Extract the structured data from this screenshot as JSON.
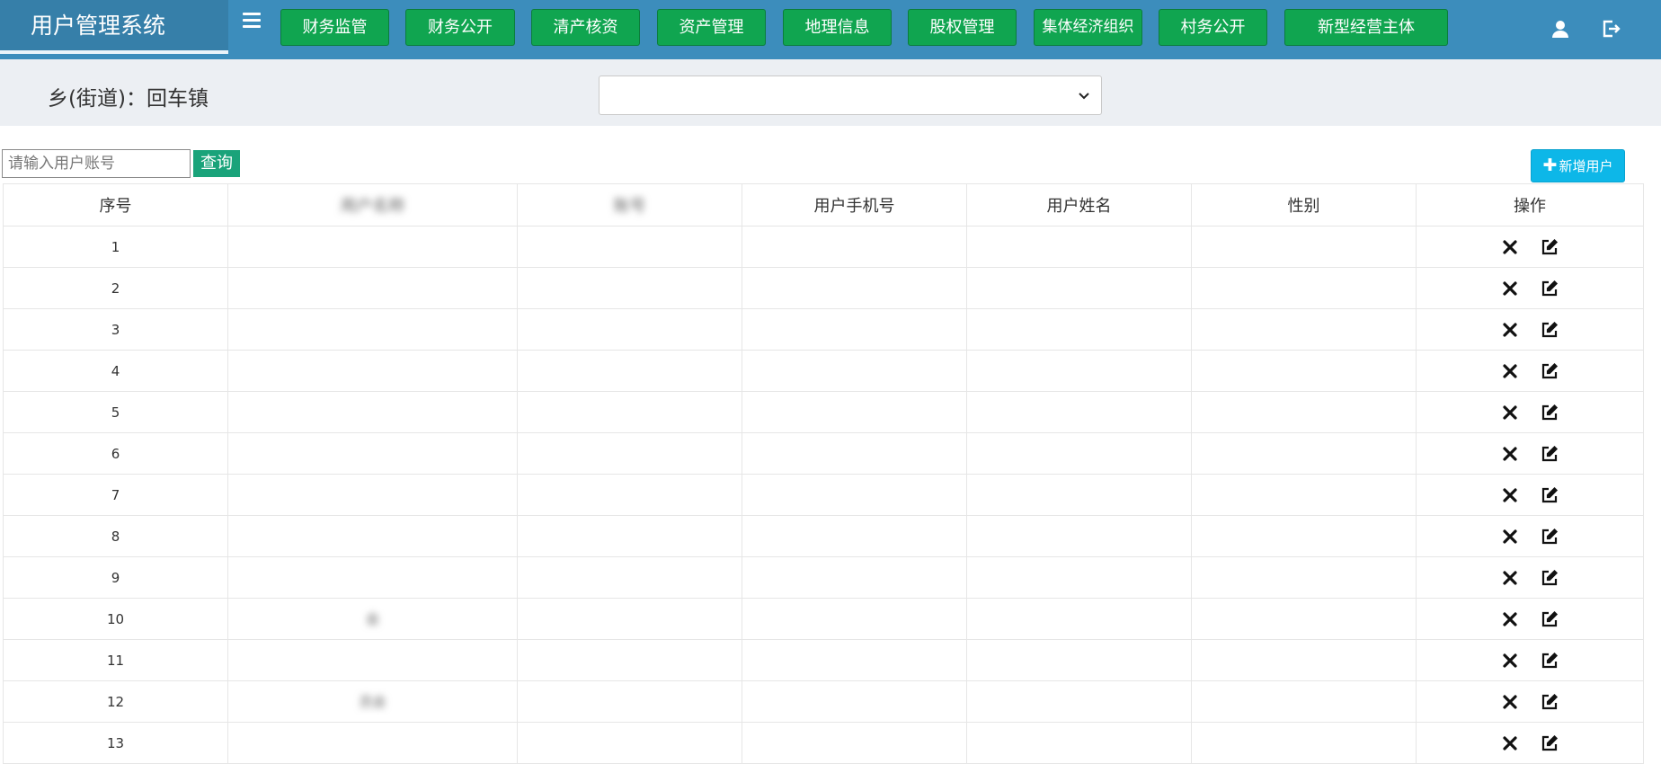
{
  "header": {
    "brand": "用户管理系统",
    "nav": [
      "财务监管",
      "财务公开",
      "清产核资",
      "资产管理",
      "地理信息",
      "股权管理",
      "集体经济组织",
      "村务公开",
      "新型经营主体"
    ],
    "icons": [
      "user-icon",
      "logout-icon"
    ]
  },
  "filter": {
    "town_label": "乡(街道)：回车镇",
    "select_value": ""
  },
  "search": {
    "placeholder": "请输入用户账号",
    "query_label": "查询"
  },
  "add_user_label": "新增用户",
  "table": {
    "headers": [
      "序号",
      "用户名称",
      "账号",
      "用户手机号",
      "用户姓名",
      "性别",
      "操作"
    ],
    "rows": [
      {
        "no": "1",
        "name": "",
        "account": "",
        "phone": "",
        "realname": "",
        "gender": ""
      },
      {
        "no": "2",
        "name": "",
        "account": "",
        "phone": "",
        "realname": "",
        "gender": ""
      },
      {
        "no": "3",
        "name": "",
        "account": "",
        "phone": "",
        "realname": "",
        "gender": ""
      },
      {
        "no": "4",
        "name": "",
        "account": "",
        "phone": "",
        "realname": "",
        "gender": ""
      },
      {
        "no": "5",
        "name": "",
        "account": "",
        "phone": "",
        "realname": "",
        "gender": ""
      },
      {
        "no": "6",
        "name": "",
        "account": "",
        "phone": "",
        "realname": "",
        "gender": ""
      },
      {
        "no": "7",
        "name": "",
        "account": "",
        "phone": "",
        "realname": "",
        "gender": ""
      },
      {
        "no": "8",
        "name": "",
        "account": "",
        "phone": "",
        "realname": "",
        "gender": ""
      },
      {
        "no": "9",
        "name": "",
        "account": "",
        "phone": "",
        "realname": "",
        "gender": ""
      },
      {
        "no": "10",
        "name": "会",
        "account": "",
        "phone": "",
        "realname": "",
        "gender": ""
      },
      {
        "no": "11",
        "name": "",
        "account": "",
        "phone": "",
        "realname": "",
        "gender": ""
      },
      {
        "no": "12",
        "name": "员会",
        "account": "",
        "phone": "",
        "realname": "",
        "gender": ""
      },
      {
        "no": "13",
        "name": "",
        "account": "",
        "phone": "",
        "realname": "",
        "gender": ""
      }
    ],
    "row_actions": [
      "delete-icon",
      "edit-icon"
    ]
  },
  "colors": {
    "header_bg": "#3c8dbc",
    "brand_bg": "#367fa9",
    "nav_btn": "#10a550",
    "filter_bg": "#eceff3",
    "query_btn": "#1aa37a",
    "add_btn": "#0db7e8"
  }
}
